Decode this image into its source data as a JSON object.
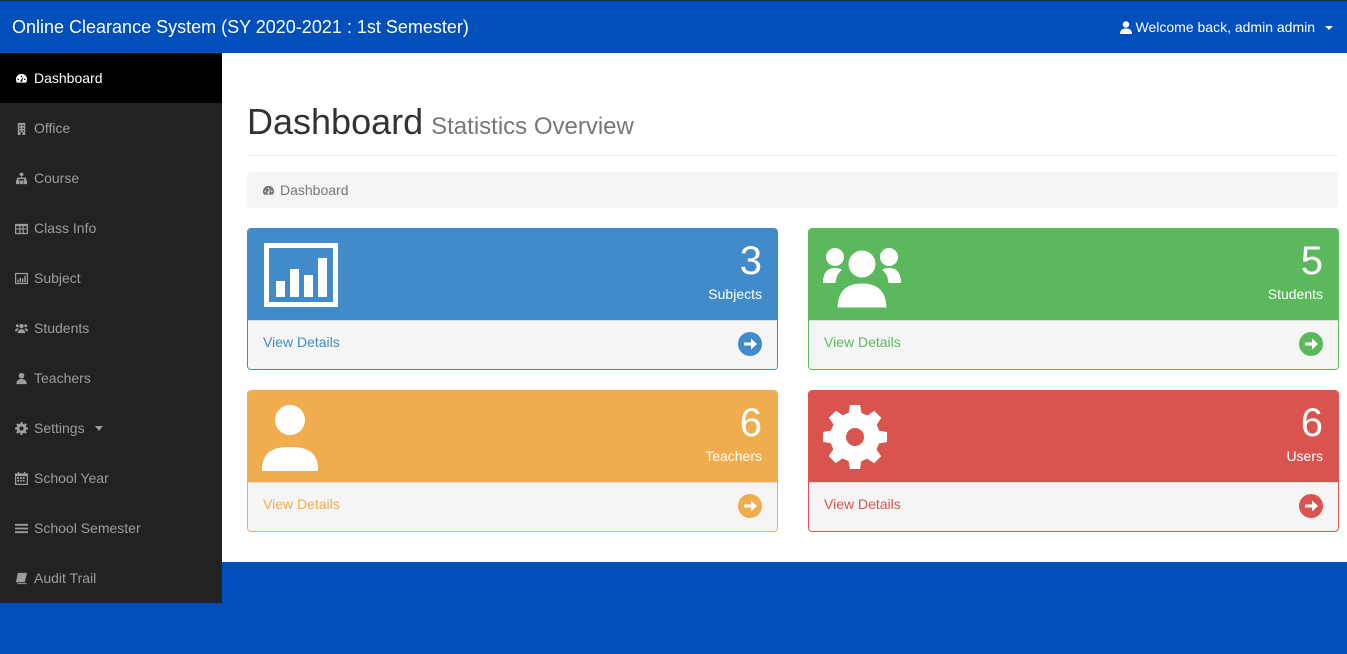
{
  "navbar": {
    "brand": "Online Clearance System (SY 2020-2021 : 1st Semester)",
    "user_label": "Welcome back, admin admin",
    "user_icon": "user-icon"
  },
  "sidebar": {
    "items": [
      {
        "label": "Dashboard",
        "icon": "dashboard-icon",
        "active": true
      },
      {
        "label": "Office",
        "icon": "building-icon"
      },
      {
        "label": "Course",
        "icon": "sitemap-icon"
      },
      {
        "label": "Class Info",
        "icon": "table-icon"
      },
      {
        "label": "Subject",
        "icon": "bar-chart-icon"
      },
      {
        "label": "Students",
        "icon": "users-icon"
      },
      {
        "label": "Teachers",
        "icon": "user-icon"
      },
      {
        "label": "Settings",
        "icon": "gear-icon",
        "dropdown": true
      },
      {
        "label": "School Year",
        "icon": "calendar-icon"
      },
      {
        "label": "School Semester",
        "icon": "list-icon"
      },
      {
        "label": "Audit Trail",
        "icon": "book-icon"
      }
    ]
  },
  "header": {
    "title": "Dashboard",
    "subtitle": "Statistics Overview"
  },
  "breadcrumb": {
    "label": "Dashboard",
    "icon": "dashboard-icon"
  },
  "panels": [
    {
      "count": "3",
      "label": "Subjects",
      "link": "View Details",
      "color": "#428bca",
      "icon": "bar-chart-icon"
    },
    {
      "count": "5",
      "label": "Students",
      "link": "View Details",
      "color": "#5cb85c",
      "icon": "users-icon"
    },
    {
      "count": "6",
      "label": "Teachers",
      "link": "View Details",
      "color": "#f0ad4e",
      "icon": "user-icon"
    },
    {
      "count": "6",
      "label": "Users",
      "link": "View Details",
      "color": "#d9534f",
      "icon": "gear-icon"
    }
  ],
  "colors": {
    "navbar": "#004fbb",
    "sidebar": "#222222",
    "sidebar_active": "#000000"
  }
}
